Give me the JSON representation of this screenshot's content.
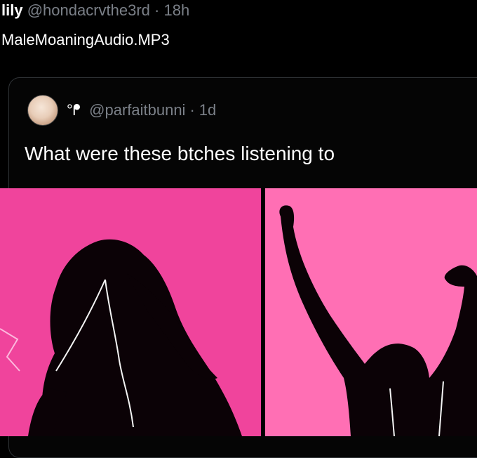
{
  "outer_tweet": {
    "name": "lily",
    "handle": "@hondacrvthe3rd",
    "separator": "·",
    "time": "18h",
    "text": "MaleMoaningAudio.MP3"
  },
  "quote_tweet": {
    "display_name": "°ᖰ",
    "handle": "@parfaitbunni",
    "separator": "·",
    "time": "1d",
    "text": "What were these btches listening to"
  },
  "media": {
    "left_bg": "#f0449c",
    "right_bg": "#ff6fb4",
    "silhouette": "#0b0206"
  }
}
